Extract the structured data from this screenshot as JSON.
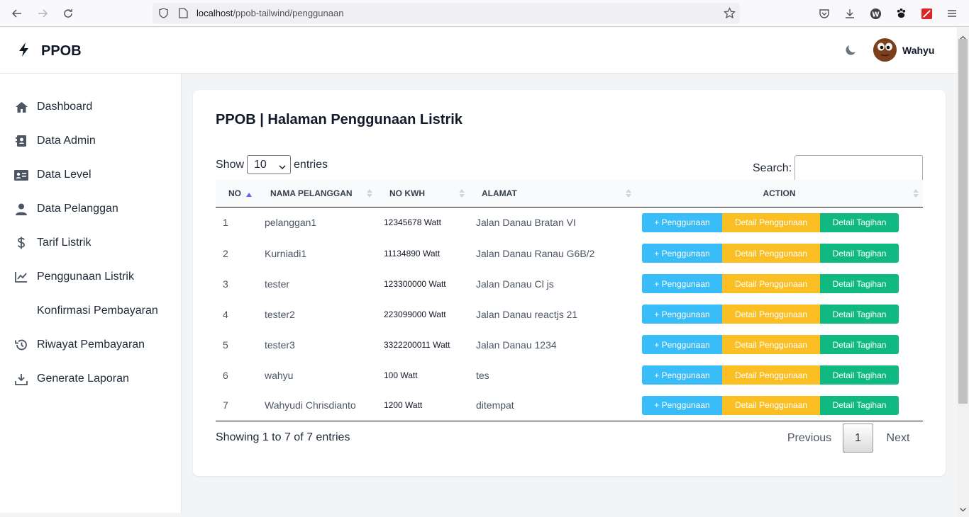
{
  "browser": {
    "url_host": "localhost",
    "url_path": "/ppob-tailwind/penggunaan"
  },
  "header": {
    "brand": "PPOB",
    "user_name": "Wahyu"
  },
  "sidebar": {
    "items": [
      {
        "label": "Dashboard",
        "icon": "home-icon"
      },
      {
        "label": "Data Admin",
        "icon": "contact-book-icon"
      },
      {
        "label": "Data Level",
        "icon": "id-card-icon"
      },
      {
        "label": "Data Pelanggan",
        "icon": "user-icon"
      },
      {
        "label": "Tarif Listrik",
        "icon": "dollar-icon"
      },
      {
        "label": "Penggunaan Listrik",
        "icon": "line-chart-icon"
      },
      {
        "label": "Konfirmasi Pembayaran",
        "icon": ""
      },
      {
        "label": "Riwayat Pembayaran",
        "icon": "history-icon"
      },
      {
        "label": "Generate Laporan",
        "icon": "download-icon"
      }
    ]
  },
  "main": {
    "title": "PPOB | Halaman Penggunaan Listrik",
    "show_label": "Show",
    "entries_value": "10",
    "entries_label": "entries",
    "search_label": "Search:",
    "columns": [
      "NO",
      "NAMA PELANGGAN",
      "NO KWH",
      "ALAMAT",
      "ACTION"
    ],
    "rows": [
      {
        "no": "1",
        "nama": "pelanggan1",
        "kwh": "12345678 Watt",
        "alamat": "Jalan Danau Bratan VI"
      },
      {
        "no": "2",
        "nama": "Kurniadi1",
        "kwh": "11134890 Watt",
        "alamat": "Jalan Danau Ranau G6B/2"
      },
      {
        "no": "3",
        "nama": "tester",
        "kwh": "123300000 Watt",
        "alamat": "Jalan Danau Cl js"
      },
      {
        "no": "4",
        "nama": "tester2",
        "kwh": "223099000 Watt",
        "alamat": "Jalan Danau reactjs 21"
      },
      {
        "no": "5",
        "nama": "tester3",
        "kwh": "3322200011 Watt",
        "alamat": "Jalan Danau 1234"
      },
      {
        "no": "6",
        "nama": "wahyu",
        "kwh": "100 Watt",
        "alamat": "tes"
      },
      {
        "no": "7",
        "nama": "Wahyudi Chrisdianto",
        "kwh": "1200 Watt",
        "alamat": "ditempat"
      }
    ],
    "actions": {
      "add": "+ Penggunaan",
      "detail": "Detail Penggunaan",
      "tagihan": "Detail Tagihan"
    },
    "info": "Showing 1 to 7 of 7 entries",
    "pagination": {
      "previous": "Previous",
      "page": "1",
      "next": "Next"
    }
  },
  "colors": {
    "add": "#38bdf8",
    "detail": "#fbbf24",
    "tagihan": "#10b981"
  }
}
